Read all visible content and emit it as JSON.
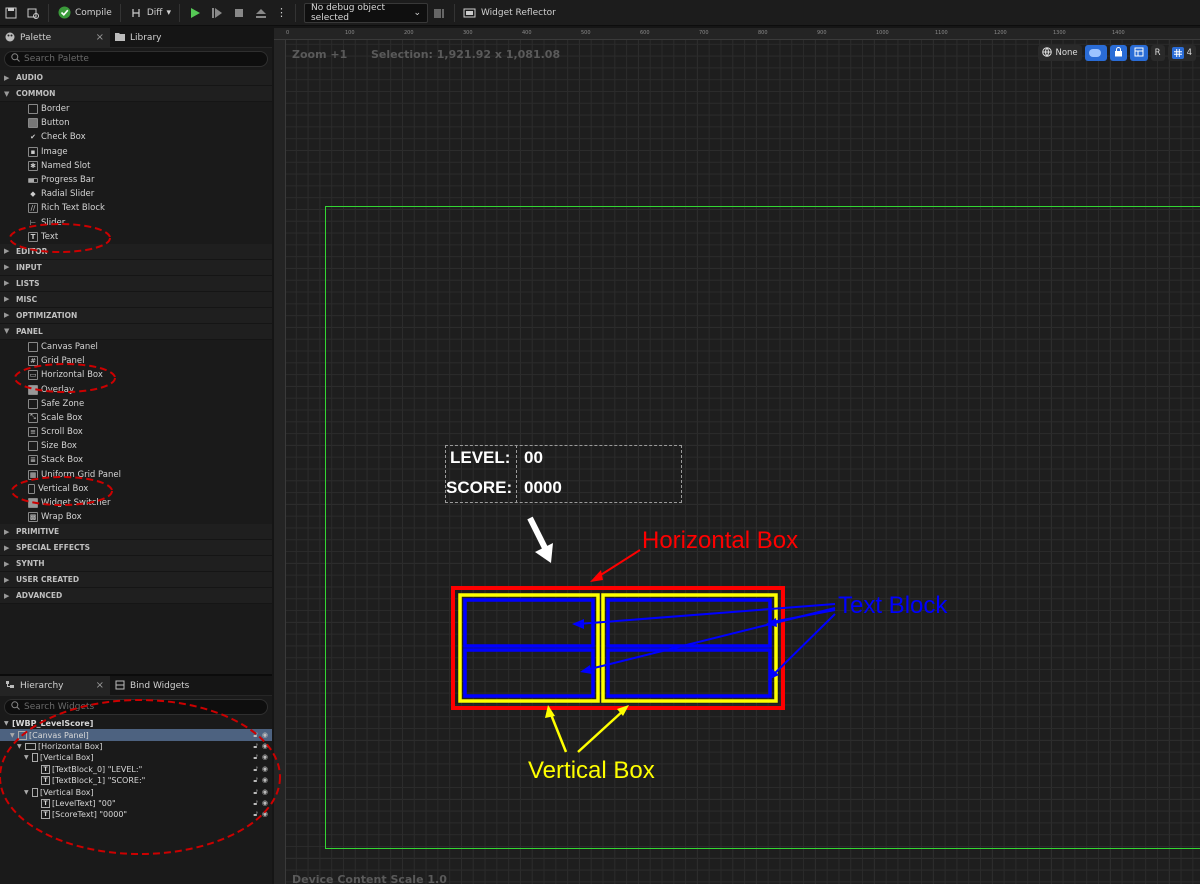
{
  "toolbar": {
    "compile_label": "Compile",
    "diff_label": "Diff",
    "debug_select": "No debug object selected",
    "widget_reflector_label": "Widget Reflector"
  },
  "palette": {
    "tab_palette": "Palette",
    "tab_library": "Library",
    "search_placeholder": "Search Palette",
    "categories": {
      "audio": "AUDIO",
      "common": "COMMON",
      "editor": "EDITOR",
      "input": "INPUT",
      "lists": "LISTS",
      "misc": "MISC",
      "optimization": "OPTIMIZATION",
      "panel": "PANEL",
      "primitive": "PRIMITIVE",
      "special_effects": "SPECIAL EFFECTS",
      "synth": "SYNTH",
      "user_created": "USER CREATED",
      "advanced": "ADVANCED"
    },
    "common_items": [
      "Border",
      "Button",
      "Check Box",
      "Image",
      "Named Slot",
      "Progress Bar",
      "Radial Slider",
      "Rich Text Block",
      "Slider",
      "Text"
    ],
    "panel_items": [
      "Canvas Panel",
      "Grid Panel",
      "Horizontal Box",
      "Overlay",
      "Safe Zone",
      "Scale Box",
      "Scroll Box",
      "Size Box",
      "Stack Box",
      "Uniform Grid Panel",
      "Vertical Box",
      "Widget Switcher",
      "Wrap Box"
    ]
  },
  "hierarchy": {
    "tab_hierarchy": "Hierarchy",
    "tab_bind_widgets": "Bind Widgets",
    "search_placeholder": "Search Widgets",
    "rows": [
      {
        "label": "[WBP_LevelScore]"
      },
      {
        "label": "[Canvas Panel]"
      },
      {
        "label": "[Horizontal Box]"
      },
      {
        "label": "[Vertical Box]"
      },
      {
        "label": "[TextBlock_0] \"LEVEL:\""
      },
      {
        "label": "[TextBlock_1] \"SCORE:\""
      },
      {
        "label": "[Vertical Box]"
      },
      {
        "label": "[LevelText] \"00\""
      },
      {
        "label": "[ScoreText] \"0000\""
      }
    ]
  },
  "viewport": {
    "zoom_label": "Zoom +1",
    "selection_label": "Selection: 1,921.92 x 1,081.08",
    "scale_label": "Device Content Scale 1.0",
    "none_label": "None",
    "r_label": "R",
    "grid_count": "4",
    "ruler_top": [
      "0",
      "100",
      "200",
      "300",
      "400",
      "500",
      "600",
      "700",
      "800",
      "900",
      "1000",
      "1100",
      "1200",
      "1300",
      "1400"
    ],
    "widget_texts": {
      "level_label": "LEVEL:",
      "level_value": "00",
      "score_label": "SCORE:",
      "score_value": "0000"
    }
  },
  "annotations": {
    "horizontal_box": "Horizontal Box",
    "text_block": "Text Block",
    "vertical_box": "Vertical Box"
  },
  "colors": {
    "horizontal_box": "#ff0000",
    "vertical_box": "#ffff00",
    "text_block": "#0000ff",
    "canvas_outline": "#33d633",
    "selection_dash": "#cc0000"
  }
}
